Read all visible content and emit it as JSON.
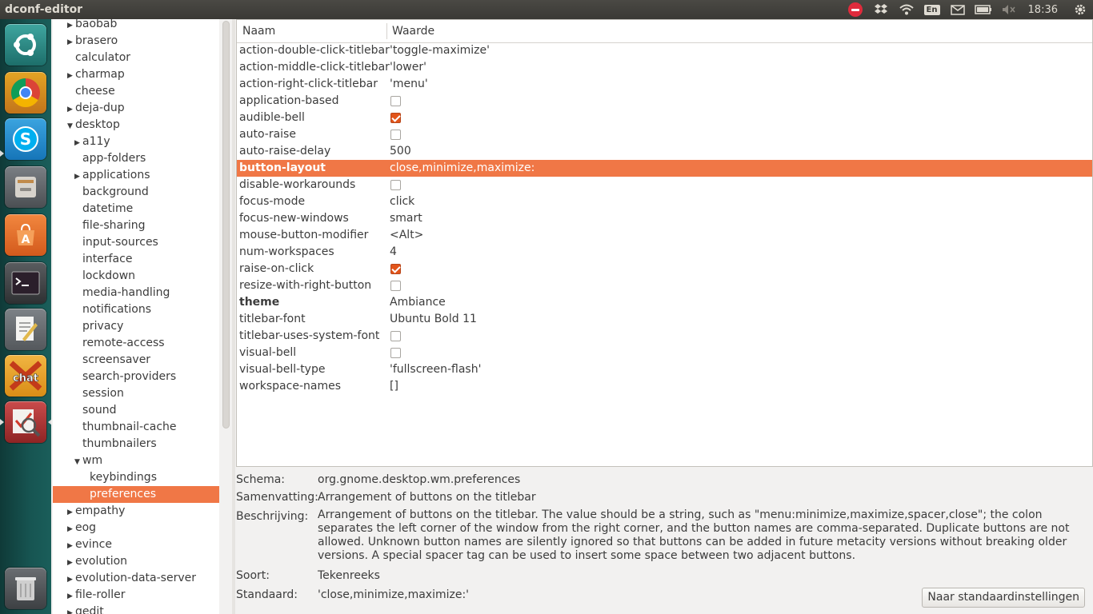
{
  "app": {
    "title": "dconf-editor"
  },
  "tray": {
    "keyboard": "En",
    "time": "18:36"
  },
  "colors": {
    "selection": "#f07746",
    "checkbox_on": "#e2541a"
  },
  "launcher": {
    "icons": [
      "ubuntu-dash-icon",
      "chrome-icon",
      "skype-icon",
      "files-icon",
      "software-center-icon",
      "terminal-icon",
      "text-editor-icon",
      "xchat-icon",
      "dconf-editor-icon",
      "trash-icon"
    ]
  },
  "tree": {
    "items": [
      {
        "label": "baobab",
        "arrow": "▶"
      },
      {
        "label": "brasero",
        "arrow": "▶"
      },
      {
        "label": "calculator",
        "arrow": ""
      },
      {
        "label": "charmap",
        "arrow": "▶"
      },
      {
        "label": "cheese",
        "arrow": ""
      },
      {
        "label": "deja-dup",
        "arrow": "▶"
      },
      {
        "label": "desktop",
        "arrow": "▼"
      },
      {
        "label": "a11y",
        "arrow": "▶"
      },
      {
        "label": "app-folders",
        "arrow": ""
      },
      {
        "label": "applications",
        "arrow": "▶"
      },
      {
        "label": "background",
        "arrow": ""
      },
      {
        "label": "datetime",
        "arrow": ""
      },
      {
        "label": "file-sharing",
        "arrow": ""
      },
      {
        "label": "input-sources",
        "arrow": ""
      },
      {
        "label": "interface",
        "arrow": ""
      },
      {
        "label": "lockdown",
        "arrow": ""
      },
      {
        "label": "media-handling",
        "arrow": ""
      },
      {
        "label": "notifications",
        "arrow": ""
      },
      {
        "label": "privacy",
        "arrow": ""
      },
      {
        "label": "remote-access",
        "arrow": ""
      },
      {
        "label": "screensaver",
        "arrow": ""
      },
      {
        "label": "search-providers",
        "arrow": ""
      },
      {
        "label": "session",
        "arrow": ""
      },
      {
        "label": "sound",
        "arrow": ""
      },
      {
        "label": "thumbnail-cache",
        "arrow": ""
      },
      {
        "label": "thumbnailers",
        "arrow": ""
      },
      {
        "label": "wm",
        "arrow": "▼"
      },
      {
        "label": "keybindings",
        "arrow": ""
      },
      {
        "label": "preferences",
        "arrow": ""
      },
      {
        "label": "empathy",
        "arrow": "▶"
      },
      {
        "label": "eog",
        "arrow": "▶"
      },
      {
        "label": "evince",
        "arrow": "▶"
      },
      {
        "label": "evolution",
        "arrow": "▶"
      },
      {
        "label": "evolution-data-server",
        "arrow": "▶"
      },
      {
        "label": "file-roller",
        "arrow": "▶"
      },
      {
        "label": "gedit",
        "arrow": "▶"
      }
    ]
  },
  "keys": {
    "col_name": "Naam",
    "col_value": "Waarde",
    "rows": [
      {
        "name": "action-double-click-titlebar",
        "value": "'toggle-maximize'"
      },
      {
        "name": "action-middle-click-titlebar",
        "value": "'lower'"
      },
      {
        "name": "action-right-click-titlebar",
        "value": "'menu'"
      },
      {
        "name": "application-based",
        "value": "",
        "checkbox": false
      },
      {
        "name": "audible-bell",
        "value": "",
        "checkbox": true
      },
      {
        "name": "auto-raise",
        "value": "",
        "checkbox": false
      },
      {
        "name": "auto-raise-delay",
        "value": "500"
      },
      {
        "name": "button-layout",
        "value": "close,minimize,maximize:"
      },
      {
        "name": "disable-workarounds",
        "value": "",
        "checkbox": false
      },
      {
        "name": "focus-mode",
        "value": "click"
      },
      {
        "name": "focus-new-windows",
        "value": "smart"
      },
      {
        "name": "mouse-button-modifier",
        "value": "<Alt>"
      },
      {
        "name": "num-workspaces",
        "value": "4"
      },
      {
        "name": "raise-on-click",
        "value": "",
        "checkbox": true
      },
      {
        "name": "resize-with-right-button",
        "value": "",
        "checkbox": false
      },
      {
        "name": "theme",
        "value": "Ambiance"
      },
      {
        "name": "titlebar-font",
        "value": "Ubuntu Bold 11"
      },
      {
        "name": "titlebar-uses-system-font",
        "value": "",
        "checkbox": false
      },
      {
        "name": "visual-bell",
        "value": "",
        "checkbox": false
      },
      {
        "name": "visual-bell-type",
        "value": "'fullscreen-flash'"
      },
      {
        "name": "workspace-names",
        "value": "[]"
      }
    ]
  },
  "info": {
    "schema_label": "Schema:",
    "schema_value": "org.gnome.desktop.wm.preferences",
    "summary_label": "Samenvatting:",
    "summary_value": "Arrangement of buttons on the titlebar",
    "description_label": "Beschrijving:",
    "description_value": "Arrangement of buttons on the titlebar. The value should be a string, such as \"menu:minimize,maximize,spacer,close\"; the colon separates the left corner of the window from the right corner, and the button names are comma-separated. Duplicate buttons are not allowed. Unknown button names are silently ignored so that buttons can be added in future metacity versions without breaking older versions. A special spacer tag can be used to insert some space between two adjacent buttons.",
    "type_label": "Soort:",
    "type_value": "Tekenreeks",
    "default_label": "Standaard:",
    "default_value": "'close,minimize,maximize:'",
    "reset_button": "Naar standaardinstellingen"
  }
}
